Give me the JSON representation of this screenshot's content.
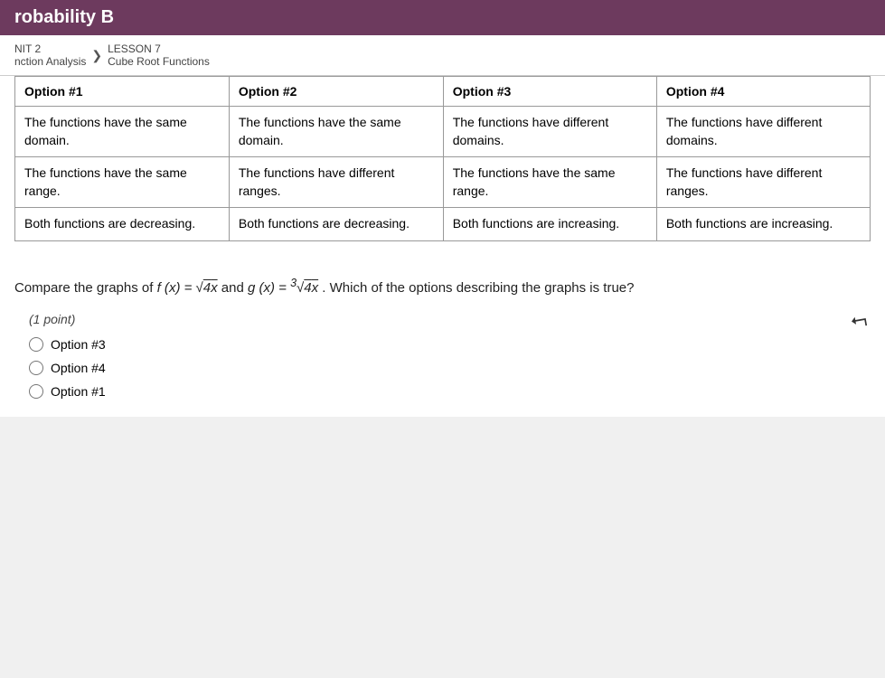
{
  "header": {
    "title": "robability B"
  },
  "breadcrumb": {
    "unit_label": "NIT 2",
    "unit_sub": "nction Analysis",
    "lesson_label": "LESSON 7",
    "lesson_sub": "Cube Root Functions"
  },
  "table": {
    "headers": [
      "Option #1",
      "Option #2",
      "Option #3",
      "Option #4"
    ],
    "rows": [
      [
        "The functions have the same domain.",
        "The functions have the same domain.",
        "The functions have different domains.",
        "The functions have different domains."
      ],
      [
        "The functions have the same range.",
        "The functions have different ranges.",
        "The functions have the same range.",
        "The functions have different ranges."
      ],
      [
        "Both functions are decreasing.",
        "Both functions are decreasing.",
        "Both functions are increasing.",
        "Both functions are increasing."
      ]
    ]
  },
  "question": {
    "text_prefix": "Compare the graphs of ",
    "f_label": "f (x) = √4x",
    "text_mid": " and ",
    "g_label": "g (x) = ∛4x",
    "text_suffix": ". Which of the options describing the graphs is true?",
    "points": "(1 point)"
  },
  "radio_options": [
    {
      "label": "Option #3",
      "value": "option3"
    },
    {
      "label": "Option #4",
      "value": "option4"
    },
    {
      "label": "Option #1",
      "value": "option1"
    }
  ]
}
